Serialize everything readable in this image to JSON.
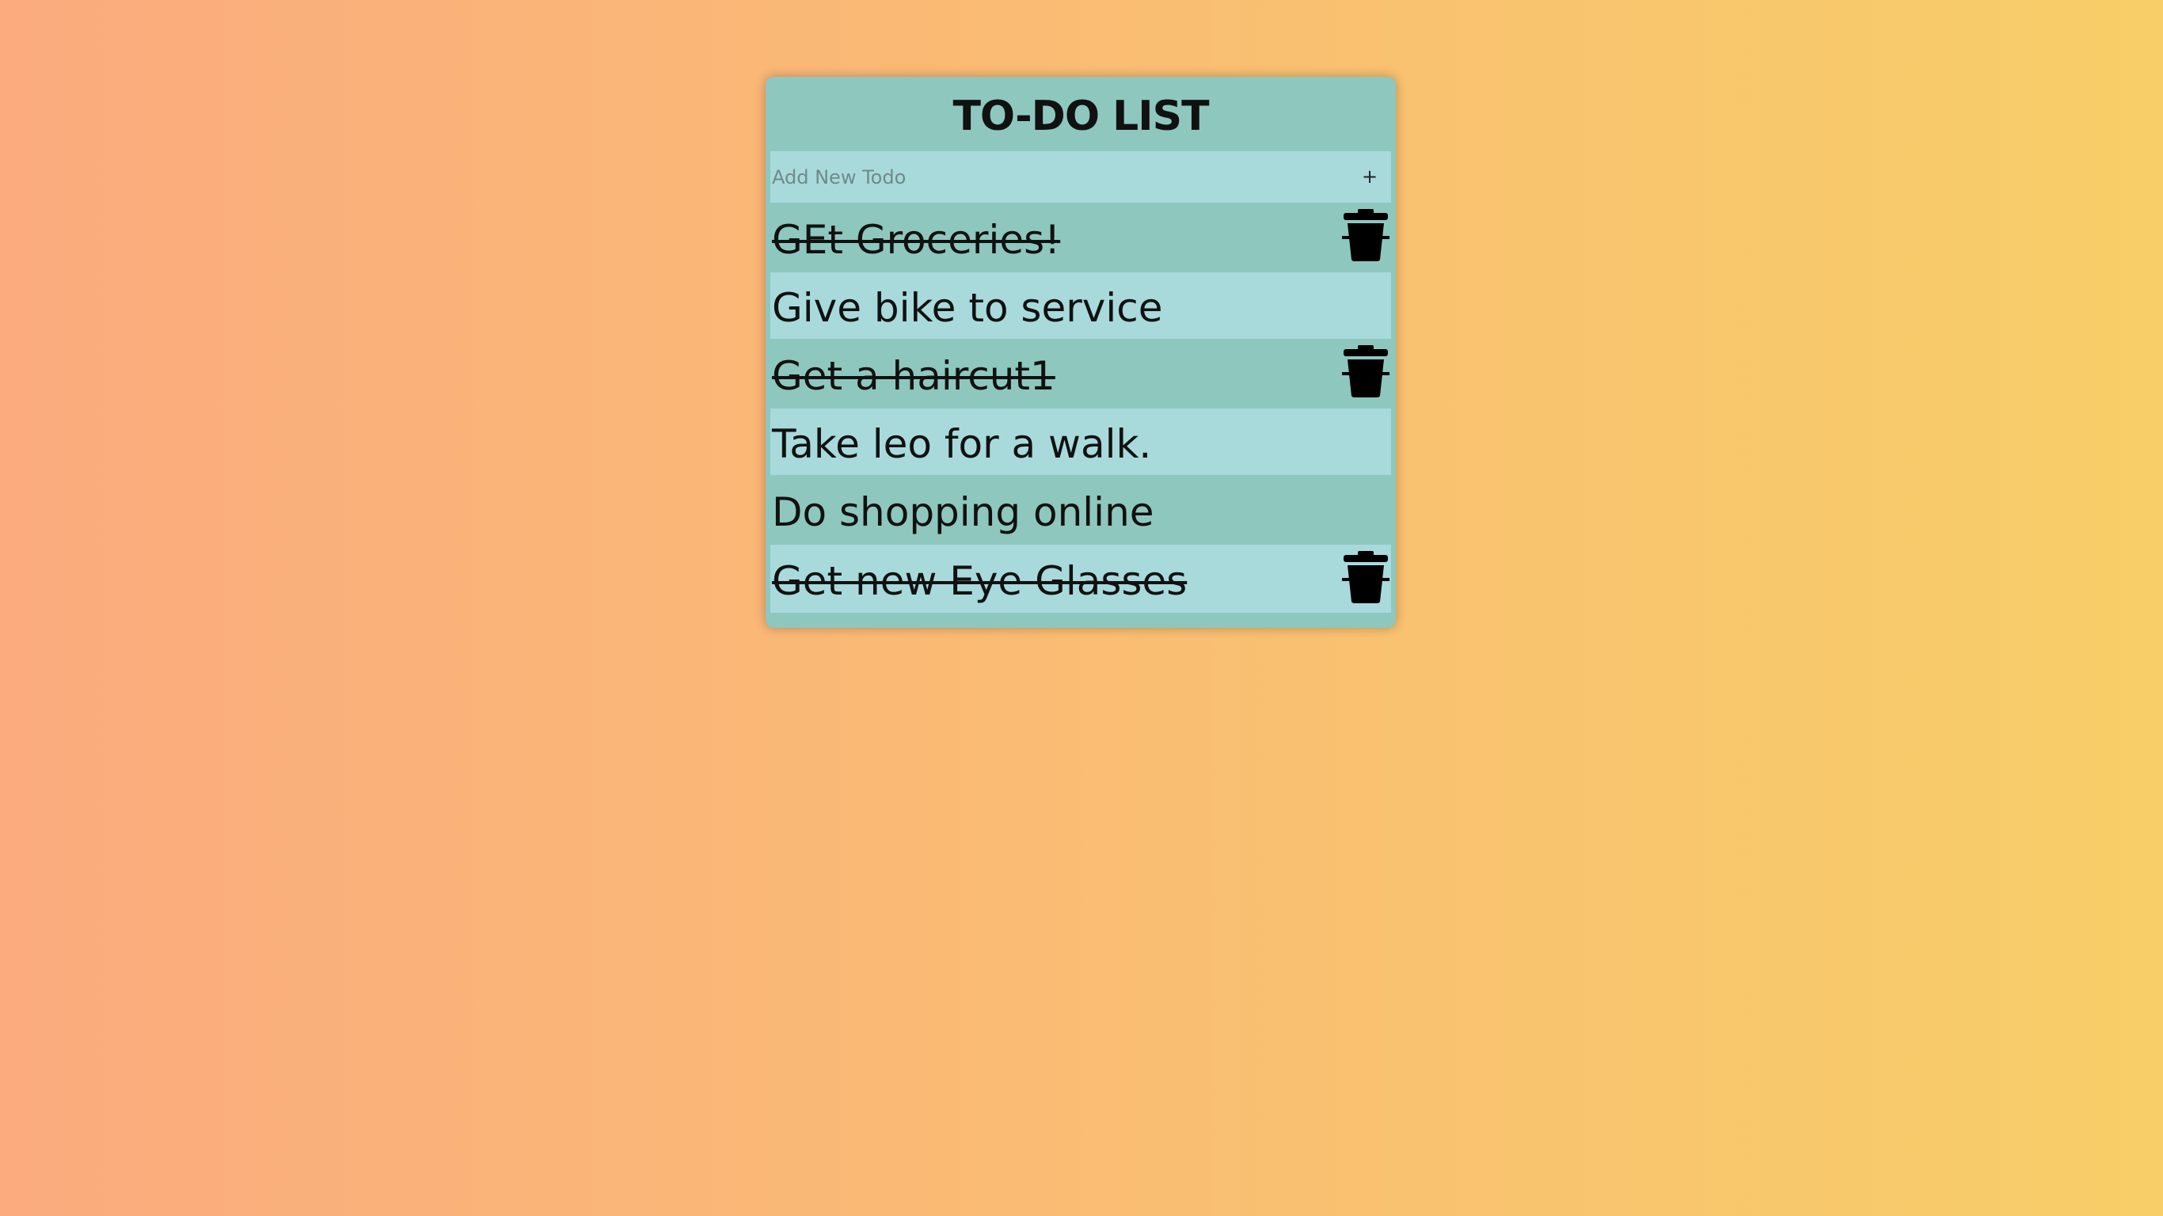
{
  "app": {
    "title": "TO-DO LIST"
  },
  "add_todo": {
    "placeholder": "Add New Todo",
    "value": "",
    "button_label": "+"
  },
  "todos": [
    {
      "text": "GEt Groceries!",
      "completed": true
    },
    {
      "text": "Give bike to service",
      "completed": false
    },
    {
      "text": "Get a haircut1",
      "completed": true
    },
    {
      "text": "Take leo for a walk.",
      "completed": false
    },
    {
      "text": "Do shopping online",
      "completed": false
    },
    {
      "text": "Get new Eye Glasses",
      "completed": true
    }
  ],
  "icons": {
    "delete": "trash-icon",
    "add": "plus-icon"
  },
  "colors": {
    "background_start": "#fbab7e",
    "background_end": "#f8ce68",
    "card": "#8ec7be",
    "row_alt": "#a8dadc",
    "text": "#111111"
  }
}
